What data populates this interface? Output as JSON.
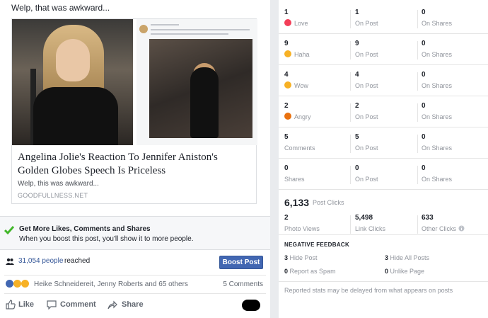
{
  "post": {
    "caption": "Welp, that was awkward...",
    "link": {
      "title": "Angelina Jolie's Reaction To Jennifer Aniston's Golden Globes Speech Is Priceless",
      "description": "Welp, this was awkward...",
      "domain": "GOODFULLNESS.NET"
    },
    "promo": {
      "title": "Get More Likes, Comments and Shares",
      "description": "When you boost this post, you'll show it to more people."
    },
    "reach": {
      "count": "31,054",
      "people_label": "people",
      "suffix": "reached"
    },
    "boost_label": "Boost Post",
    "reactions": {
      "names": "Heike Schneidereit, Jenny Roberts and 65 others",
      "comments": "5 Comments"
    },
    "actions": {
      "like": "Like",
      "comment": "Comment",
      "share": "Share"
    }
  },
  "insights": {
    "rows": [
      {
        "total": "1",
        "label": "Love",
        "icon": "love-icon",
        "color": "#f33e58",
        "on_post": "1",
        "on_post_label": "On Post",
        "on_shares": "0",
        "on_shares_label": "On Shares"
      },
      {
        "total": "9",
        "label": "Haha",
        "icon": "haha-icon",
        "color": "#f7b125",
        "on_post": "9",
        "on_post_label": "On Post",
        "on_shares": "0",
        "on_shares_label": "On Shares"
      },
      {
        "total": "4",
        "label": "Wow",
        "icon": "wow-icon",
        "color": "#f7b125",
        "on_post": "4",
        "on_post_label": "On Post",
        "on_shares": "0",
        "on_shares_label": "On Shares"
      },
      {
        "total": "2",
        "label": "Angry",
        "icon": "angry-icon",
        "color": "#e9710f",
        "on_post": "2",
        "on_post_label": "On Post",
        "on_shares": "0",
        "on_shares_label": "On Shares"
      },
      {
        "total": "5",
        "label": "Comments",
        "on_post": "5",
        "on_post_label": "On Post",
        "on_shares": "0",
        "on_shares_label": "On Shares"
      },
      {
        "total": "0",
        "label": "Shares",
        "on_post": "0",
        "on_post_label": "On Post",
        "on_shares": "0",
        "on_shares_label": "On Shares"
      }
    ],
    "post_clicks": {
      "total": "6,133",
      "label": "Post Clicks",
      "photo_views": "2",
      "photo_views_label": "Photo Views",
      "link_clicks": "5,498",
      "link_clicks_label": "Link Clicks",
      "other_clicks": "633",
      "other_clicks_label": "Other Clicks"
    },
    "negative": {
      "title": "NEGATIVE FEEDBACK",
      "hide_post": "3",
      "hide_post_label": "Hide Post",
      "hide_all": "3",
      "hide_all_label": "Hide All Posts",
      "spam": "0",
      "spam_label": "Report as Spam",
      "unlike": "0",
      "unlike_label": "Unlike Page"
    },
    "note": "Reported stats may be delayed from what appears on posts"
  },
  "colors": {
    "accent": "#4267b2",
    "link": "#365899",
    "check": "#42b72a"
  }
}
